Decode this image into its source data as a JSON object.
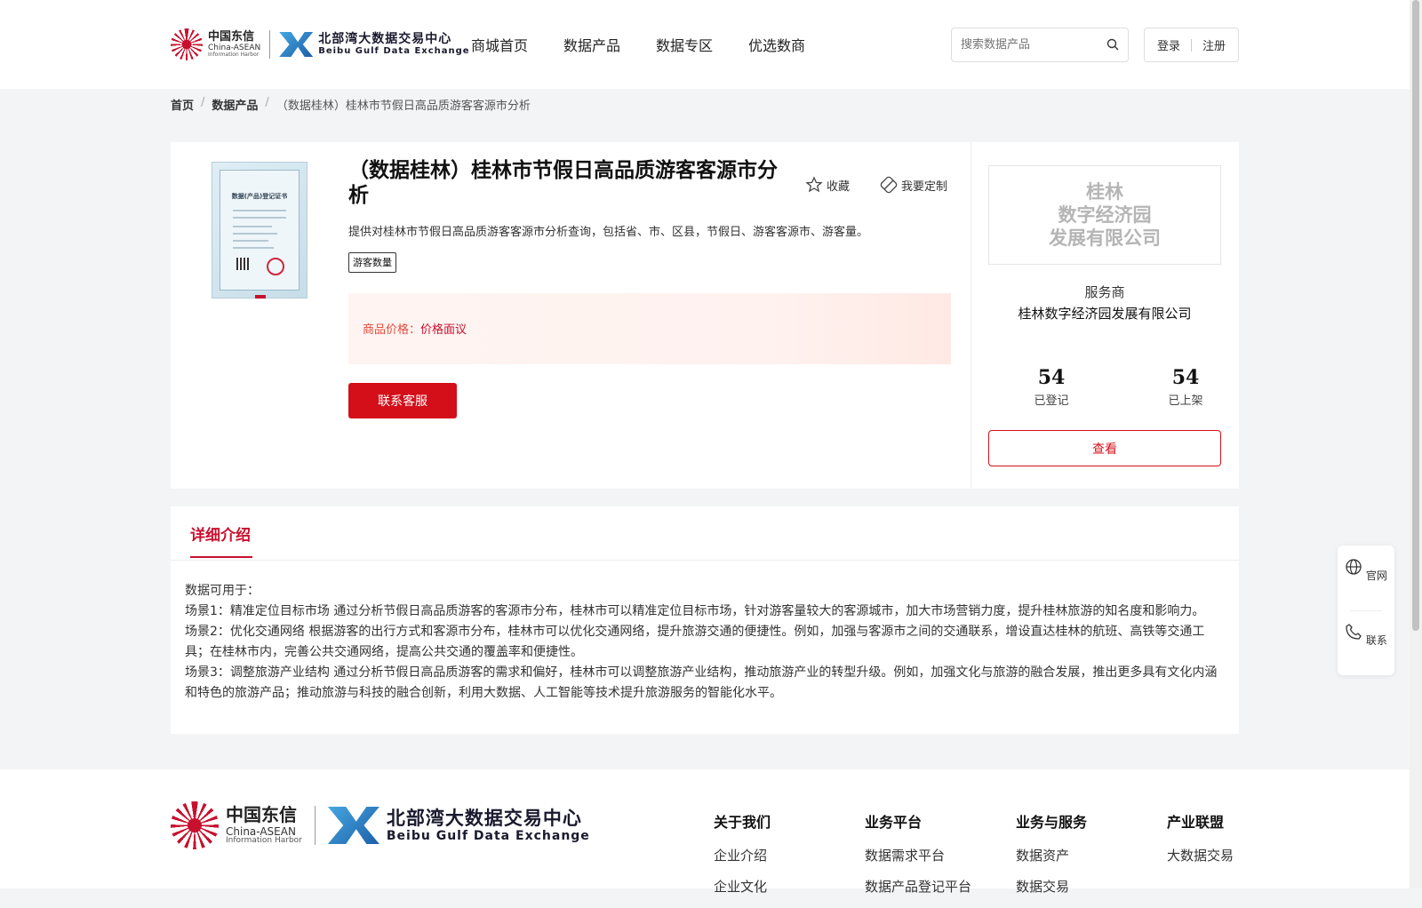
{
  "header": {
    "logo_cn": "中国东信",
    "logo_en1": "China-ASEAN",
    "logo_en2": "Information Harbor",
    "logo2_cn": "北部湾大数据交易中心",
    "logo2_en": "Beibu Gulf Data Exchange",
    "nav": [
      "商城首页",
      "数据产品",
      "数据专区",
      "优选数商"
    ],
    "search_placeholder": "搜索数据产品",
    "login": "登录",
    "register": "注册"
  },
  "breadcrumb": {
    "home": "首页",
    "section": "数据产品",
    "current": "（数据桂林）桂林市节假日高品质游客客源市分析"
  },
  "product": {
    "thumb_title": "数据(产品)登记证书",
    "title": "（数据桂林）桂林市节假日高品质游客客源市分析",
    "favorite": "收藏",
    "customize": "我要定制",
    "description": "提供对桂林市节假日高品质游客客源市分析查询，包括省、市、区县，节假日、游客客源市、游客量。",
    "tag": "游客数量",
    "price_label": "商品价格：",
    "price_value": "价格面议",
    "contact_button": "联系客服"
  },
  "provider": {
    "logo_lines": [
      "桂林",
      "数字经济园",
      "发展有限公司"
    ],
    "role": "服务商",
    "name": "桂林数字经济园发展有限公司",
    "registered_count": "54",
    "registered_label": "已登记",
    "listed_count": "54",
    "listed_label": "已上架",
    "view_button": "查看"
  },
  "detail": {
    "tab": "详细介绍",
    "paragraphs": [
      "数据可用于：",
      "场景1：精准定位目标市场 通过分析节假日高品质游客的客源市分布，桂林市可以精准定位目标市场，针对游客量较大的客源城市，加大市场营销力度，提升桂林旅游的知名度和影响力。",
      "场景2：优化交通网络 根据游客的出行方式和客源市分布，桂林市可以优化交通网络，提升旅游交通的便捷性。例如，加强与客源市之间的交通联系，增设直达桂林的航班、高铁等交通工具；在桂林市内，完善公共交通网络，提高公共交通的覆盖率和便捷性。",
      " 场景3：调整旅游产业结构 通过分析节假日高品质游客的需求和偏好，桂林市可以调整旅游产业结构，推动旅游产业的转型升级。例如，加强文化与旅游的融合发展，推出更多具有文化内涵和特色的旅游产品；推动旅游与科技的融合创新，利用大数据、人工智能等技术提升旅游服务的智能化水平。"
    ]
  },
  "float": {
    "website": "官网",
    "contact": "联系"
  },
  "footer": {
    "columns": [
      {
        "title": "关于我们",
        "items": [
          "企业介绍",
          "企业文化"
        ]
      },
      {
        "title": "业务平台",
        "items": [
          "数据需求平台",
          "数据产品登记平台"
        ]
      },
      {
        "title": "业务与服务",
        "items": [
          "数据资产",
          "数据交易"
        ]
      },
      {
        "title": "产业联盟",
        "items": [
          "大数据交易"
        ]
      }
    ]
  }
}
